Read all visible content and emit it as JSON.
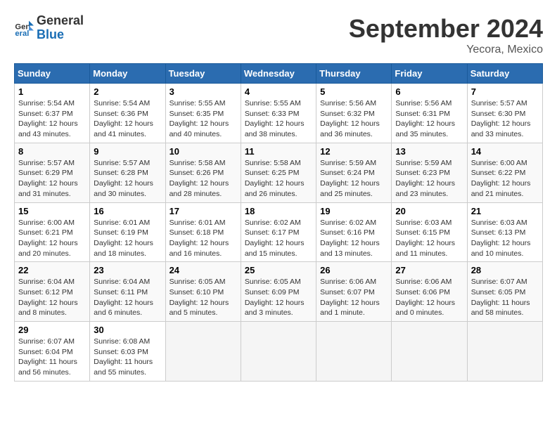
{
  "header": {
    "logo_line1": "General",
    "logo_line2": "Blue",
    "month_title": "September 2024",
    "location": "Yecora, Mexico"
  },
  "days_of_week": [
    "Sunday",
    "Monday",
    "Tuesday",
    "Wednesday",
    "Thursday",
    "Friday",
    "Saturday"
  ],
  "weeks": [
    [
      {
        "day": "1",
        "sunrise": "Sunrise: 5:54 AM",
        "sunset": "Sunset: 6:37 PM",
        "daylight": "Daylight: 12 hours and 43 minutes."
      },
      {
        "day": "2",
        "sunrise": "Sunrise: 5:54 AM",
        "sunset": "Sunset: 6:36 PM",
        "daylight": "Daylight: 12 hours and 41 minutes."
      },
      {
        "day": "3",
        "sunrise": "Sunrise: 5:55 AM",
        "sunset": "Sunset: 6:35 PM",
        "daylight": "Daylight: 12 hours and 40 minutes."
      },
      {
        "day": "4",
        "sunrise": "Sunrise: 5:55 AM",
        "sunset": "Sunset: 6:33 PM",
        "daylight": "Daylight: 12 hours and 38 minutes."
      },
      {
        "day": "5",
        "sunrise": "Sunrise: 5:56 AM",
        "sunset": "Sunset: 6:32 PM",
        "daylight": "Daylight: 12 hours and 36 minutes."
      },
      {
        "day": "6",
        "sunrise": "Sunrise: 5:56 AM",
        "sunset": "Sunset: 6:31 PM",
        "daylight": "Daylight: 12 hours and 35 minutes."
      },
      {
        "day": "7",
        "sunrise": "Sunrise: 5:57 AM",
        "sunset": "Sunset: 6:30 PM",
        "daylight": "Daylight: 12 hours and 33 minutes."
      }
    ],
    [
      {
        "day": "8",
        "sunrise": "Sunrise: 5:57 AM",
        "sunset": "Sunset: 6:29 PM",
        "daylight": "Daylight: 12 hours and 31 minutes."
      },
      {
        "day": "9",
        "sunrise": "Sunrise: 5:57 AM",
        "sunset": "Sunset: 6:28 PM",
        "daylight": "Daylight: 12 hours and 30 minutes."
      },
      {
        "day": "10",
        "sunrise": "Sunrise: 5:58 AM",
        "sunset": "Sunset: 6:26 PM",
        "daylight": "Daylight: 12 hours and 28 minutes."
      },
      {
        "day": "11",
        "sunrise": "Sunrise: 5:58 AM",
        "sunset": "Sunset: 6:25 PM",
        "daylight": "Daylight: 12 hours and 26 minutes."
      },
      {
        "day": "12",
        "sunrise": "Sunrise: 5:59 AM",
        "sunset": "Sunset: 6:24 PM",
        "daylight": "Daylight: 12 hours and 25 minutes."
      },
      {
        "day": "13",
        "sunrise": "Sunrise: 5:59 AM",
        "sunset": "Sunset: 6:23 PM",
        "daylight": "Daylight: 12 hours and 23 minutes."
      },
      {
        "day": "14",
        "sunrise": "Sunrise: 6:00 AM",
        "sunset": "Sunset: 6:22 PM",
        "daylight": "Daylight: 12 hours and 21 minutes."
      }
    ],
    [
      {
        "day": "15",
        "sunrise": "Sunrise: 6:00 AM",
        "sunset": "Sunset: 6:21 PM",
        "daylight": "Daylight: 12 hours and 20 minutes."
      },
      {
        "day": "16",
        "sunrise": "Sunrise: 6:01 AM",
        "sunset": "Sunset: 6:19 PM",
        "daylight": "Daylight: 12 hours and 18 minutes."
      },
      {
        "day": "17",
        "sunrise": "Sunrise: 6:01 AM",
        "sunset": "Sunset: 6:18 PM",
        "daylight": "Daylight: 12 hours and 16 minutes."
      },
      {
        "day": "18",
        "sunrise": "Sunrise: 6:02 AM",
        "sunset": "Sunset: 6:17 PM",
        "daylight": "Daylight: 12 hours and 15 minutes."
      },
      {
        "day": "19",
        "sunrise": "Sunrise: 6:02 AM",
        "sunset": "Sunset: 6:16 PM",
        "daylight": "Daylight: 12 hours and 13 minutes."
      },
      {
        "day": "20",
        "sunrise": "Sunrise: 6:03 AM",
        "sunset": "Sunset: 6:15 PM",
        "daylight": "Daylight: 12 hours and 11 minutes."
      },
      {
        "day": "21",
        "sunrise": "Sunrise: 6:03 AM",
        "sunset": "Sunset: 6:13 PM",
        "daylight": "Daylight: 12 hours and 10 minutes."
      }
    ],
    [
      {
        "day": "22",
        "sunrise": "Sunrise: 6:04 AM",
        "sunset": "Sunset: 6:12 PM",
        "daylight": "Daylight: 12 hours and 8 minutes."
      },
      {
        "day": "23",
        "sunrise": "Sunrise: 6:04 AM",
        "sunset": "Sunset: 6:11 PM",
        "daylight": "Daylight: 12 hours and 6 minutes."
      },
      {
        "day": "24",
        "sunrise": "Sunrise: 6:05 AM",
        "sunset": "Sunset: 6:10 PM",
        "daylight": "Daylight: 12 hours and 5 minutes."
      },
      {
        "day": "25",
        "sunrise": "Sunrise: 6:05 AM",
        "sunset": "Sunset: 6:09 PM",
        "daylight": "Daylight: 12 hours and 3 minutes."
      },
      {
        "day": "26",
        "sunrise": "Sunrise: 6:06 AM",
        "sunset": "Sunset: 6:07 PM",
        "daylight": "Daylight: 12 hours and 1 minute."
      },
      {
        "day": "27",
        "sunrise": "Sunrise: 6:06 AM",
        "sunset": "Sunset: 6:06 PM",
        "daylight": "Daylight: 12 hours and 0 minutes."
      },
      {
        "day": "28",
        "sunrise": "Sunrise: 6:07 AM",
        "sunset": "Sunset: 6:05 PM",
        "daylight": "Daylight: 11 hours and 58 minutes."
      }
    ],
    [
      {
        "day": "29",
        "sunrise": "Sunrise: 6:07 AM",
        "sunset": "Sunset: 6:04 PM",
        "daylight": "Daylight: 11 hours and 56 minutes."
      },
      {
        "day": "30",
        "sunrise": "Sunrise: 6:08 AM",
        "sunset": "Sunset: 6:03 PM",
        "daylight": "Daylight: 11 hours and 55 minutes."
      },
      null,
      null,
      null,
      null,
      null
    ]
  ]
}
